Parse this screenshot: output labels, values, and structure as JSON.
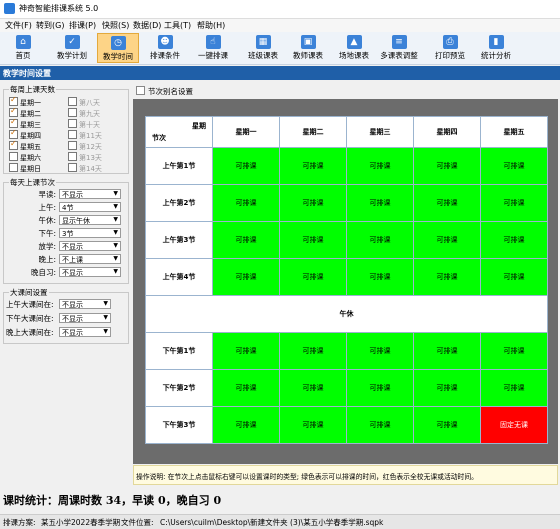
{
  "app": {
    "title": "神奇智能排课系统 5.0"
  },
  "menu": [
    "文件(F)",
    "转到(G)",
    "排课(P)",
    "快照(S)",
    "数据(D)",
    "工具(T)",
    "帮助(H)"
  ],
  "toolbar": [
    {
      "label": "首页",
      "icon": "home-icon"
    },
    {
      "label": "教学计划",
      "icon": "clipboard-check-icon"
    },
    {
      "label": "教学时间",
      "icon": "clock-icon",
      "active": true
    },
    {
      "label": "排课条件",
      "icon": "people-icon"
    },
    {
      "label": "一键排课",
      "icon": "hand-click-icon"
    },
    {
      "label": "班级课表",
      "icon": "calendar-grid-icon"
    },
    {
      "label": "教师课表",
      "icon": "teacher-card-icon"
    },
    {
      "label": "场地课表",
      "icon": "building-icon"
    },
    {
      "label": "多课表调整",
      "icon": "adjust-document-icon"
    },
    {
      "label": "打印预览",
      "icon": "print-preview-icon"
    },
    {
      "label": "统计分析",
      "icon": "bar-chart-icon"
    }
  ],
  "section_title": "教学时间设置",
  "left": {
    "days_title": "每周上课天数",
    "days": [
      {
        "label": "星期一",
        "checked": true
      },
      {
        "label": "星期二",
        "checked": true
      },
      {
        "label": "星期三",
        "checked": true
      },
      {
        "label": "星期四",
        "checked": true
      },
      {
        "label": "星期五",
        "checked": true
      },
      {
        "label": "星期六",
        "checked": false
      },
      {
        "label": "星期日",
        "checked": false
      }
    ],
    "extra_days": [
      "第八天",
      "第九天",
      "第十天",
      "第11天",
      "第12天",
      "第13天",
      "第14天"
    ],
    "periods_title": "每天上课节次",
    "periods": [
      {
        "label": "早读:",
        "value": "不显示"
      },
      {
        "label": "上午:",
        "value": "4节"
      },
      {
        "label": "午休:",
        "value": "显示午休"
      },
      {
        "label": "下午:",
        "value": "3节"
      },
      {
        "label": "放学:",
        "value": "不显示"
      },
      {
        "label": "晚上:",
        "value": "不上课"
      },
      {
        "label": "晚自习:",
        "value": "不显示"
      }
    ],
    "break_title": "大课间设置",
    "breaks": [
      {
        "label": "上午大课间在:",
        "value": "不显示"
      },
      {
        "label": "下午大课间在:",
        "value": "不显示"
      },
      {
        "label": "晚上大课间在:",
        "value": "不显示"
      }
    ]
  },
  "main": {
    "alias_button": "节次别名设置",
    "corner_top": "星期",
    "corner_bottom": "节次",
    "days": [
      "星期一",
      "星期二",
      "星期三",
      "星期四",
      "星期五"
    ],
    "morning": [
      "上午第1节",
      "上午第2节",
      "上午第3节",
      "上午第4节"
    ],
    "noon": "午休",
    "afternoon": [
      "下午第1节",
      "下午第2节",
      "下午第3节"
    ],
    "cell_ok": "可排课",
    "cell_blocked": "固定无课",
    "blocked": [
      {
        "row": "下午第3节",
        "day": "星期五"
      }
    ],
    "colors": {
      "available": "#00ff00",
      "blocked": "#ff0000"
    },
    "info": "操作说明: 在节次上点击鼠标右键可以设置课时的类型; 绿色表示可以排课的时间，红色表示全校无课或活动时间。"
  },
  "stats": "课时统计：周课时数 34，早读 0，晚自习 0",
  "status": {
    "plan_label": "排课方案:",
    "plan_value": "某五小学2022春季学期",
    "file_label": "文件位置:",
    "file_value": "C:\\Users\\cuilm\\Desktop\\新建文件夹 (3)\\某五小学春季学期.sqpk"
  }
}
